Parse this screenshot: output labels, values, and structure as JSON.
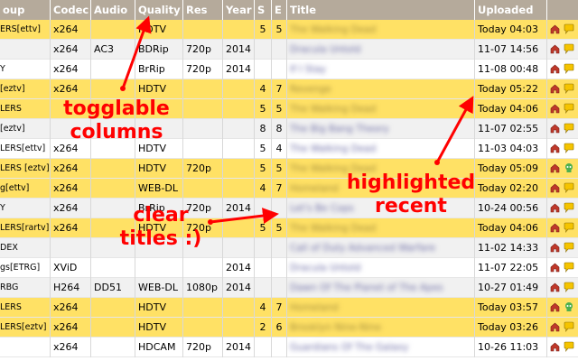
{
  "table": {
    "headers": [
      {
        "key": "group",
        "label": "oup"
      },
      {
        "key": "codec",
        "label": "Codec"
      },
      {
        "key": "audio",
        "label": "Audio"
      },
      {
        "key": "quality",
        "label": "Quality"
      },
      {
        "key": "res",
        "label": "Res"
      },
      {
        "key": "year",
        "label": "Year"
      },
      {
        "key": "s",
        "label": "S"
      },
      {
        "key": "e",
        "label": "E"
      },
      {
        "key": "title",
        "label": "Title"
      },
      {
        "key": "uploaded",
        "label": "Uploaded"
      }
    ],
    "rows": [
      {
        "group": "ERS[ettv]",
        "codec": "x264",
        "audio": "",
        "quality": "HDTV",
        "res": "",
        "year": "",
        "s": "5",
        "e": "5",
        "title": "The Walking Dead",
        "uploaded": "Today 04:03",
        "highlight": true,
        "bubble": "speech"
      },
      {
        "group": "",
        "codec": "x264",
        "audio": "AC3",
        "quality": "BDRip",
        "res": "720p",
        "year": "2014",
        "s": "",
        "e": "",
        "title": "Dracula Untold",
        "uploaded": "11-07 14:56",
        "highlight": false,
        "bubble": "speech"
      },
      {
        "group": "Y",
        "codec": "x264",
        "audio": "",
        "quality": "BrRip",
        "res": "720p",
        "year": "2014",
        "s": "",
        "e": "",
        "title": "If I Stay",
        "uploaded": "11-08 00:48",
        "highlight": false,
        "bubble": "speech"
      },
      {
        "group": "[eztv]",
        "codec": "x264",
        "audio": "",
        "quality": "HDTV",
        "res": "",
        "year": "",
        "s": "4",
        "e": "7",
        "title": "Revenge",
        "uploaded": "Today 05:22",
        "highlight": true,
        "bubble": "speech"
      },
      {
        "group": "LERS",
        "codec": "",
        "audio": "",
        "quality": "",
        "res": "",
        "year": "",
        "s": "5",
        "e": "5",
        "title": "The Walking Dead",
        "uploaded": "Today 04:06",
        "highlight": true,
        "bubble": "speech"
      },
      {
        "group": "[eztv]",
        "codec": "",
        "audio": "",
        "quality": "",
        "res": "",
        "year": "",
        "s": "8",
        "e": "8",
        "title": "The Big Bang Theory",
        "uploaded": "11-07 02:55",
        "highlight": false,
        "bubble": "speech"
      },
      {
        "group": "LERS[ettv]",
        "codec": "x264",
        "audio": "",
        "quality": "HDTV",
        "res": "",
        "year": "",
        "s": "5",
        "e": "4",
        "title": "The Walking Dead",
        "uploaded": "11-03 04:03",
        "highlight": false,
        "bubble": "speech"
      },
      {
        "group": "LERS [eztv]",
        "codec": "x264",
        "audio": "",
        "quality": "HDTV",
        "res": "720p",
        "year": "",
        "s": "5",
        "e": "5",
        "title": "The Walking Dead",
        "uploaded": "Today 05:09",
        "highlight": true,
        "bubble": "skull"
      },
      {
        "group": "g[ettv]",
        "codec": "x264",
        "audio": "",
        "quality": "WEB-DL",
        "res": "",
        "year": "",
        "s": "4",
        "e": "7",
        "title": "Homeland",
        "uploaded": "Today 02:20",
        "highlight": true,
        "bubble": "speech"
      },
      {
        "group": "Y",
        "codec": "x264",
        "audio": "",
        "quality": "BrRip",
        "res": "720p",
        "year": "2014",
        "s": "",
        "e": "",
        "title": "Let's Be Cops",
        "uploaded": "10-24 00:56",
        "highlight": false,
        "bubble": "speech"
      },
      {
        "group": "LERS[rartv]",
        "codec": "x264",
        "audio": "",
        "quality": "HDTV",
        "res": "720p",
        "year": "",
        "s": "5",
        "e": "5",
        "title": "The Walking Dead",
        "uploaded": "Today 04:06",
        "highlight": true,
        "bubble": "speech"
      },
      {
        "group": "DEX",
        "codec": "",
        "audio": "",
        "quality": "",
        "res": "",
        "year": "",
        "s": "",
        "e": "",
        "title": "Call of Duty Advanced Warfare",
        "uploaded": "11-02 14:33",
        "highlight": false,
        "bubble": "speech"
      },
      {
        "group": "gs[ETRG]",
        "codec": "XViD",
        "audio": "",
        "quality": "",
        "res": "",
        "year": "2014",
        "s": "",
        "e": "",
        "title": "Dracula Untold",
        "uploaded": "11-07 22:05",
        "highlight": false,
        "bubble": "speech"
      },
      {
        "group": "RBG",
        "codec": "H264",
        "audio": "DD51",
        "quality": "WEB-DL",
        "res": "1080p",
        "year": "2014",
        "s": "",
        "e": "",
        "title": "Dawn Of The Planet of The Apes",
        "uploaded": "10-27 01:49",
        "highlight": false,
        "bubble": "speech"
      },
      {
        "group": "LERS",
        "codec": "x264",
        "audio": "",
        "quality": "HDTV",
        "res": "",
        "year": "",
        "s": "4",
        "e": "7",
        "title": "Homeland",
        "uploaded": "Today 03:57",
        "highlight": true,
        "bubble": "skull"
      },
      {
        "group": "LERS[eztv]",
        "codec": "x264",
        "audio": "",
        "quality": "HDTV",
        "res": "",
        "year": "",
        "s": "2",
        "e": "6",
        "title": "Brooklyn Nine-Nine",
        "uploaded": "Today 03:26",
        "highlight": true,
        "bubble": "speech"
      },
      {
        "group": "",
        "codec": "x264",
        "audio": "",
        "quality": "HDCAM",
        "res": "720p",
        "year": "2014",
        "s": "",
        "e": "",
        "title": "Guardians Of The Galaxy",
        "uploaded": "10-26 11:03",
        "highlight": false,
        "bubble": "speech"
      }
    ]
  },
  "annotations": {
    "togglable": "togglable\ncolumns",
    "highlighted": "highlighted\nrecent",
    "clear": "clear\ntitles :)"
  },
  "colors": {
    "header_bg": "#b5aa9b",
    "highlight_row": "#ffe165",
    "annotation": "#ff0000",
    "house_icon": "#c0392b",
    "bubble_icon": "#f5c400",
    "skull_icon": "#4caf50"
  },
  "icons": {
    "magnet": "magnet-icon",
    "comment": "comment-bubble-icon",
    "skull": "skull-icon"
  }
}
